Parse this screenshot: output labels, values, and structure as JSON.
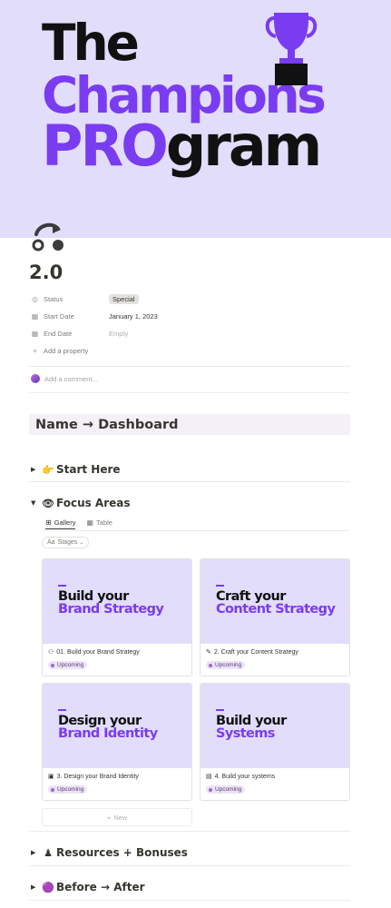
{
  "cover": {
    "line1": "The",
    "line2": "Champions",
    "line3_a": "PRO",
    "line3_b": "gram",
    "colors": {
      "background": "#e2ddfb",
      "purple": "#7a3cf0",
      "black": "#111111"
    }
  },
  "page": {
    "icon": "redo-arrow-icon",
    "title": "2.0"
  },
  "properties": [
    {
      "icon": "status-icon",
      "label": "Status",
      "value": "Special",
      "kind": "tag"
    },
    {
      "icon": "calendar-icon",
      "label": "Start Date",
      "value": "January 1, 2023",
      "kind": "text"
    },
    {
      "icon": "calendar-icon",
      "label": "End Date",
      "value": "Empty",
      "kind": "empty"
    }
  ],
  "add_property": "Add a property",
  "comment_placeholder": "Add a comment...",
  "callout": {
    "text": "Name → Dashboard"
  },
  "sections": {
    "start_here": {
      "emoji": "👉",
      "label": "Start Here"
    },
    "focus_areas": {
      "emoji": "👁",
      "label": "Focus Areas"
    },
    "resources": {
      "emoji": "♟",
      "label": "Resources + Bonuses"
    },
    "before_after": {
      "emoji": "🟣",
      "label": "Before → After"
    }
  },
  "views": {
    "gallery": "Gallery",
    "table": "Table"
  },
  "filter": {
    "prefix": "Aa",
    "label": "Stages"
  },
  "cards": [
    {
      "cover_l1": "Build your",
      "cover_l2": "Brand Strategy",
      "icon": "binoculars-icon",
      "glyph": "⚇",
      "name": "01. Build your Brand Strategy",
      "status": "Upcoming"
    },
    {
      "cover_l1": "Craft your",
      "cover_l2": "Content Strategy",
      "icon": "write-icon",
      "glyph": "✎",
      "name": "2. Craft your Content Strategy",
      "status": "Upcoming"
    },
    {
      "cover_l1": "Design your",
      "cover_l2": "Brand Identity",
      "icon": "palette-icon",
      "glyph": "▣",
      "name": "3. Design your Brand Identity",
      "status": "Upcoming"
    },
    {
      "cover_l1": "Build your",
      "cover_l2": "Systems",
      "icon": "toolbox-icon",
      "glyph": "▤",
      "name": "4. Build your systems",
      "status": "Upcoming"
    }
  ],
  "new_button": "New"
}
